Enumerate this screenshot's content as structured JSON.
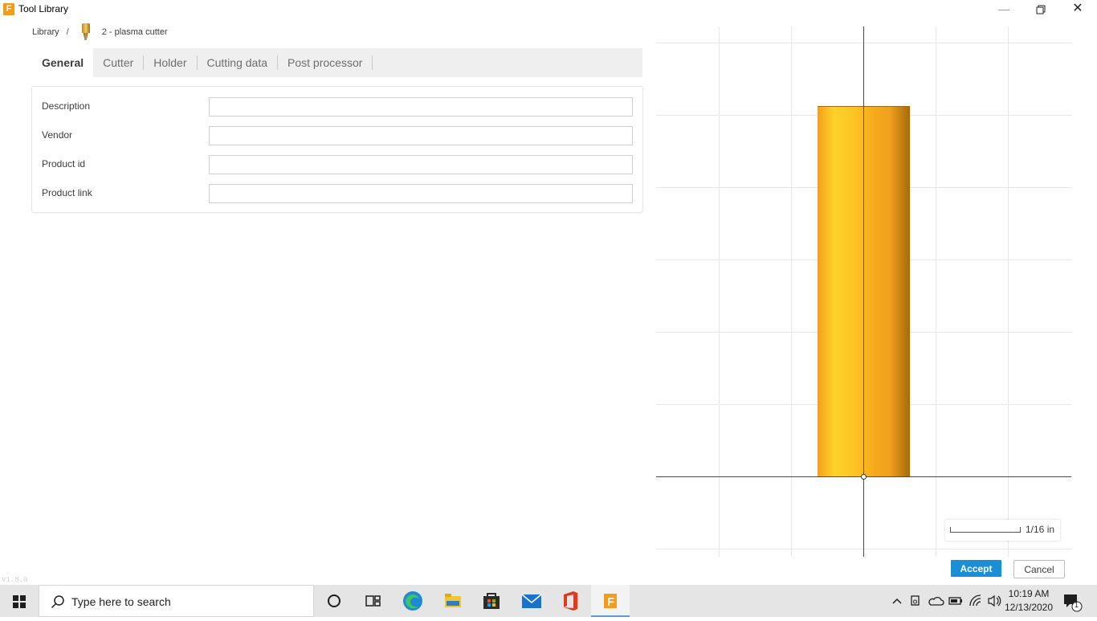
{
  "window": {
    "title": "Tool Library",
    "app_icon_letter": "F"
  },
  "breadcrumb": {
    "root": "Library",
    "separator": "/",
    "current": "2 - plasma cutter"
  },
  "tabs": [
    {
      "label": "General",
      "active": true
    },
    {
      "label": "Cutter",
      "active": false
    },
    {
      "label": "Holder",
      "active": false
    },
    {
      "label": "Cutting data",
      "active": false
    },
    {
      "label": "Post processor",
      "active": false
    }
  ],
  "form": {
    "fields": [
      {
        "label": "Description",
        "value": ""
      },
      {
        "label": "Vendor",
        "value": ""
      },
      {
        "label": "Product id",
        "value": ""
      },
      {
        "label": "Product link",
        "value": ""
      }
    ]
  },
  "version": "v1.8.0",
  "preview": {
    "scale_label": "1/16 in",
    "tool_color": "#f7b21e",
    "grid_color": "#d8ecf3"
  },
  "actions": {
    "accept_label": "Accept",
    "cancel_label": "Cancel",
    "accent": "#1a8fd6"
  },
  "taskbar": {
    "search_placeholder": "Type here to search",
    "apps": [
      "cortana-icon",
      "task-view-icon",
      "edge-icon",
      "file-explorer-icon",
      "store-icon",
      "mail-icon",
      "office-icon",
      "fusion-icon"
    ],
    "time": "10:19 AM",
    "date": "12/13/2020",
    "notification_count": "1"
  }
}
